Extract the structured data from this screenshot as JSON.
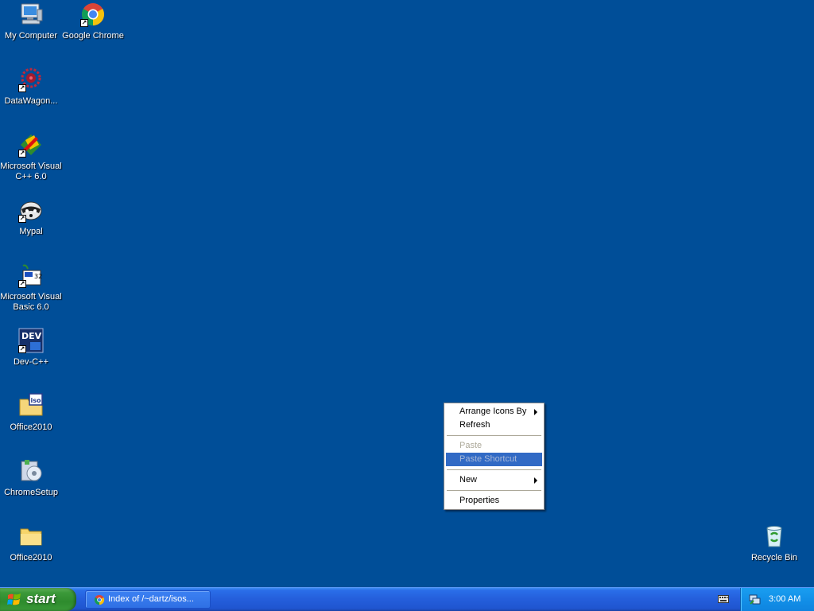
{
  "desktop": {
    "background": "#004e98",
    "icons": [
      {
        "label": "My Computer",
        "icon": "my-computer-icon",
        "shortcut": false
      },
      {
        "label": "Google Chrome",
        "icon": "chrome-icon",
        "shortcut": true
      },
      {
        "label": "DataWagon...",
        "icon": "datawagon-icon",
        "shortcut": true
      },
      {
        "label": "Microsoft Visual\nC++ 6.0",
        "icon": "visual-cpp-icon",
        "shortcut": true
      },
      {
        "label": "Mypal",
        "icon": "mypal-icon",
        "shortcut": true
      },
      {
        "label": "Microsoft Visual\nBasic 6.0",
        "icon": "visual-basic-icon",
        "shortcut": true
      },
      {
        "label": "Dev-C++",
        "icon": "dev-cpp-icon",
        "shortcut": true
      },
      {
        "label": "Office2010",
        "icon": "iso-folder-icon",
        "shortcut": false
      },
      {
        "label": "ChromeSetup",
        "icon": "installer-icon",
        "shortcut": false
      },
      {
        "label": "Office2010",
        "icon": "folder-icon",
        "shortcut": false
      },
      {
        "label": "Recycle Bin",
        "icon": "recycle-bin-icon",
        "shortcut": false
      }
    ]
  },
  "context_menu": {
    "items": [
      {
        "label": "Arrange Icons By",
        "submenu": true,
        "disabled": false
      },
      {
        "label": "Refresh",
        "submenu": false,
        "disabled": false
      },
      {
        "label": "Paste",
        "submenu": false,
        "disabled": true
      },
      {
        "label": "Paste Shortcut",
        "submenu": false,
        "disabled": true,
        "highlighted": true
      },
      {
        "label": "New",
        "submenu": true,
        "disabled": false
      },
      {
        "label": "Properties",
        "submenu": false,
        "disabled": false
      }
    ],
    "highlight_color": "#316ac5"
  },
  "taskbar": {
    "start_label": "start",
    "tasks": [
      {
        "label": "Index of /~dartz/isos...",
        "icon": "chrome-icon"
      }
    ],
    "tray": {
      "clock": "3:00 AM",
      "icons": [
        "keyboard-icon",
        "network-icon"
      ]
    }
  }
}
